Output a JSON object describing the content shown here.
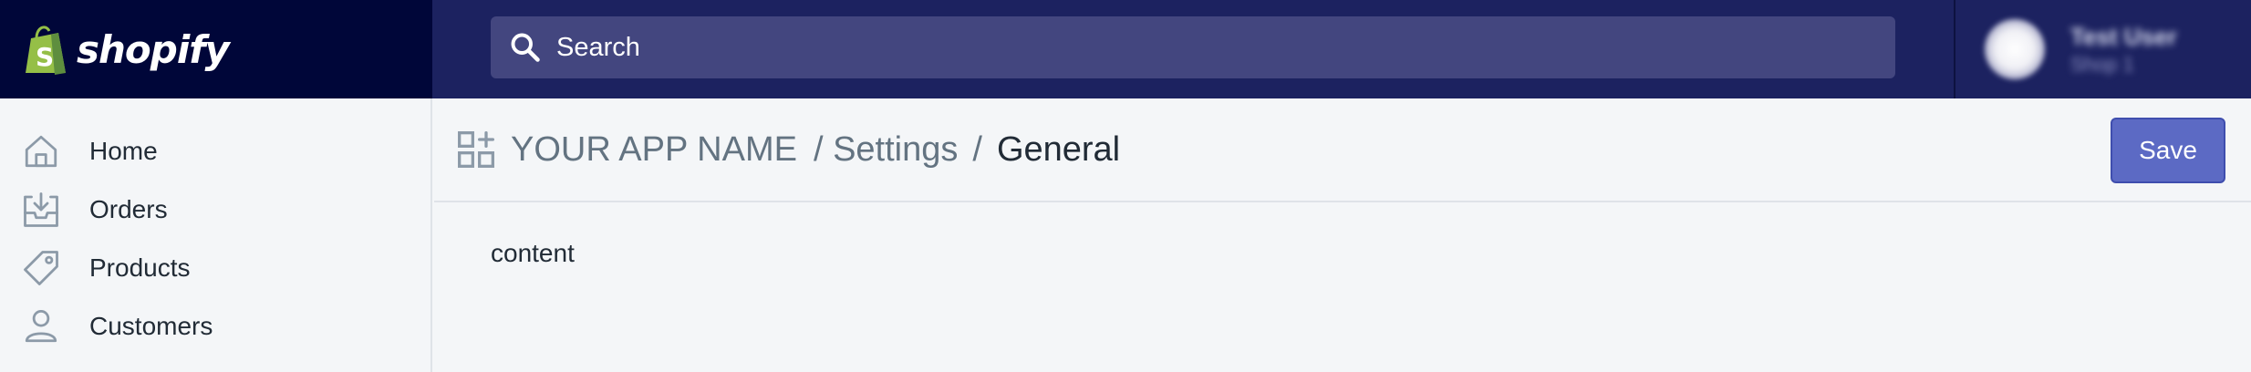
{
  "brand": {
    "name": "shopify",
    "logo_icon": "shopify-bag-icon"
  },
  "search": {
    "placeholder": "Search",
    "icon": "search-icon"
  },
  "user": {
    "name": "Test User",
    "shop": "Shop 1"
  },
  "sidebar": {
    "items": [
      {
        "label": "Home",
        "icon": "home-icon"
      },
      {
        "label": "Orders",
        "icon": "orders-icon"
      },
      {
        "label": "Products",
        "icon": "tag-icon"
      },
      {
        "label": "Customers",
        "icon": "person-icon"
      }
    ]
  },
  "breadcrumb": {
    "app_name": "YOUR APP NAME",
    "section": "/ Settings",
    "separator": "/",
    "current": "General",
    "icon": "apps-icon"
  },
  "actions": {
    "save_label": "Save"
  },
  "main": {
    "content": "content"
  },
  "colors": {
    "topbar": "#1c2260",
    "logo_bg": "#000639",
    "search_bg": "#43467f",
    "accent": "#5c6ac4",
    "brand_green": "#95bf47",
    "background": "#f4f6f8"
  }
}
